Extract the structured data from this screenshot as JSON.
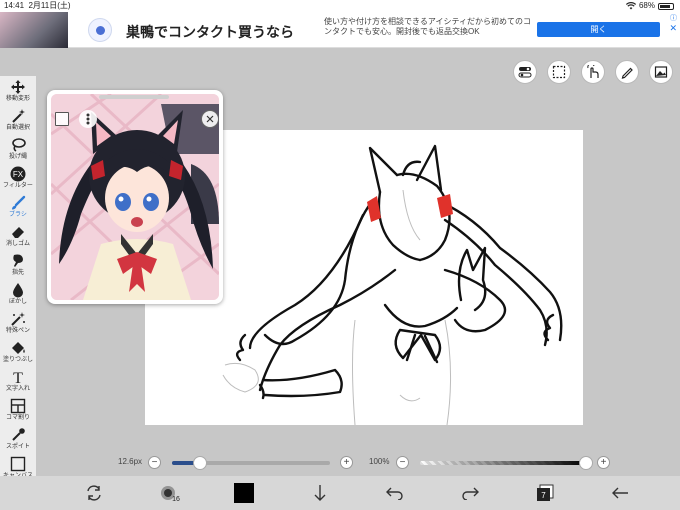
{
  "status_bar": {
    "time": "14:41",
    "date": "2月11日(土)",
    "battery": "68%"
  },
  "ad": {
    "headline": "巣鴨でコンタクト買うなら",
    "body": "使い方や付け方を相談できるアイシティだから初めてのコンタクトでも安心。開封後でも返品交換OK",
    "cta": "開く",
    "info_icon": "ⓘ",
    "close_icon": "✕"
  },
  "toolbar": {
    "active_index": 4,
    "tools": [
      {
        "label": "移動変形",
        "icon": "move-icon"
      },
      {
        "label": "自動選択",
        "icon": "magic-wand-icon"
      },
      {
        "label": "投げ縄",
        "icon": "lasso-icon"
      },
      {
        "label": "フィルター",
        "icon": "fx-icon",
        "icon_text": "FX"
      },
      {
        "label": "ブラシ",
        "icon": "brush-icon"
      },
      {
        "label": "消しゴム",
        "icon": "eraser-icon"
      },
      {
        "label": "指先",
        "icon": "finger-icon"
      },
      {
        "label": "ぼかし",
        "icon": "blur-icon"
      },
      {
        "label": "特殊ペン",
        "icon": "special-pen-icon"
      },
      {
        "label": "塗りつぶし",
        "icon": "fill-icon"
      },
      {
        "label": "文字入れ",
        "icon": "text-icon",
        "icon_text": "T"
      },
      {
        "label": "コマ割り",
        "icon": "frame-divider-icon"
      },
      {
        "label": "スポイト",
        "icon": "eyedropper-icon"
      },
      {
        "label": "キャンバス",
        "icon": "canvas-icon"
      }
    ]
  },
  "brush_size": {
    "value": "12.6px",
    "fill_fraction": 0.18
  },
  "opacity": {
    "value": "100%",
    "fill_fraction": 1.0
  },
  "colors": {
    "accent": "#2f7bd6",
    "size_track_fill": "#2b4e8c",
    "current_color": "#000000",
    "layer_count": "7"
  },
  "bottom_bar": {
    "layer_count": "7",
    "brush_preview_count": "16"
  }
}
